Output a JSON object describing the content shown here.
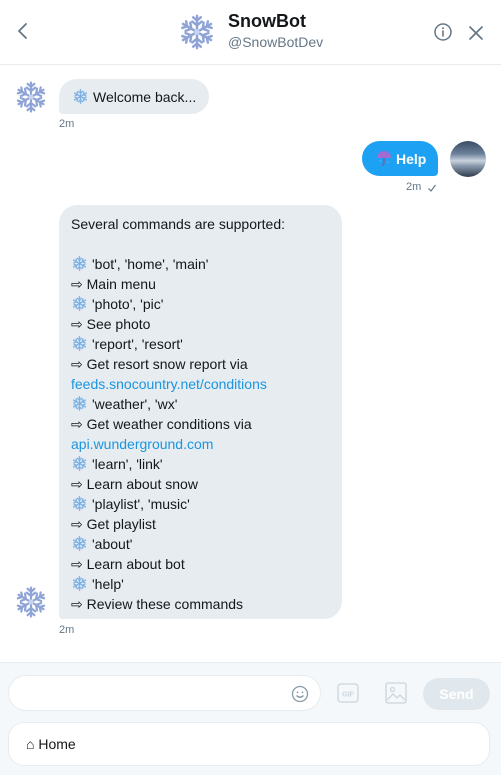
{
  "header": {
    "name": "SnowBot",
    "handle": "@SnowBotDev"
  },
  "colors": {
    "accent": "#1da1f2",
    "link": "#1b95e0",
    "bubble_in": "#e6ecf0"
  },
  "messages": {
    "welcome": {
      "text": "Welcome back...",
      "time": "2m"
    },
    "help": {
      "text": "Help",
      "time": "2m",
      "status_icon": "check-icon"
    },
    "commands": {
      "time": "2m",
      "lines": [
        {
          "text": "Several commands are supported:"
        },
        {
          "text": ""
        },
        {
          "snow": true,
          "text": "'bot', 'home', 'main'"
        },
        {
          "text": "⇨ Main menu"
        },
        {
          "snow": true,
          "text": "'photo', 'pic'"
        },
        {
          "text": "⇨ See photo"
        },
        {
          "snow": true,
          "text": "'report', 'resort'"
        },
        {
          "text": "⇨ Get resort snow report via"
        },
        {
          "link": true,
          "text": "feeds.snocountry.net/conditions"
        },
        {
          "snow": true,
          "text": "'weather', 'wx'"
        },
        {
          "text": "⇨ Get weather conditions via"
        },
        {
          "link": true,
          "text": "api.wunderground.com"
        },
        {
          "snow": true,
          "text": "'learn', 'link'"
        },
        {
          "text": "⇨ Learn about snow"
        },
        {
          "snow": true,
          "text": "'playlist', 'music'"
        },
        {
          "text": "⇨ Get playlist"
        },
        {
          "snow": true,
          "text": "'about'"
        },
        {
          "text": "⇨ Learn about bot"
        },
        {
          "snow": true,
          "text": "'help'"
        },
        {
          "text": "⇨ Review these commands"
        }
      ]
    }
  },
  "composer": {
    "input_value": "",
    "gif_label": "GIF",
    "send_label": "Send",
    "home_label": "⌂ Home"
  }
}
